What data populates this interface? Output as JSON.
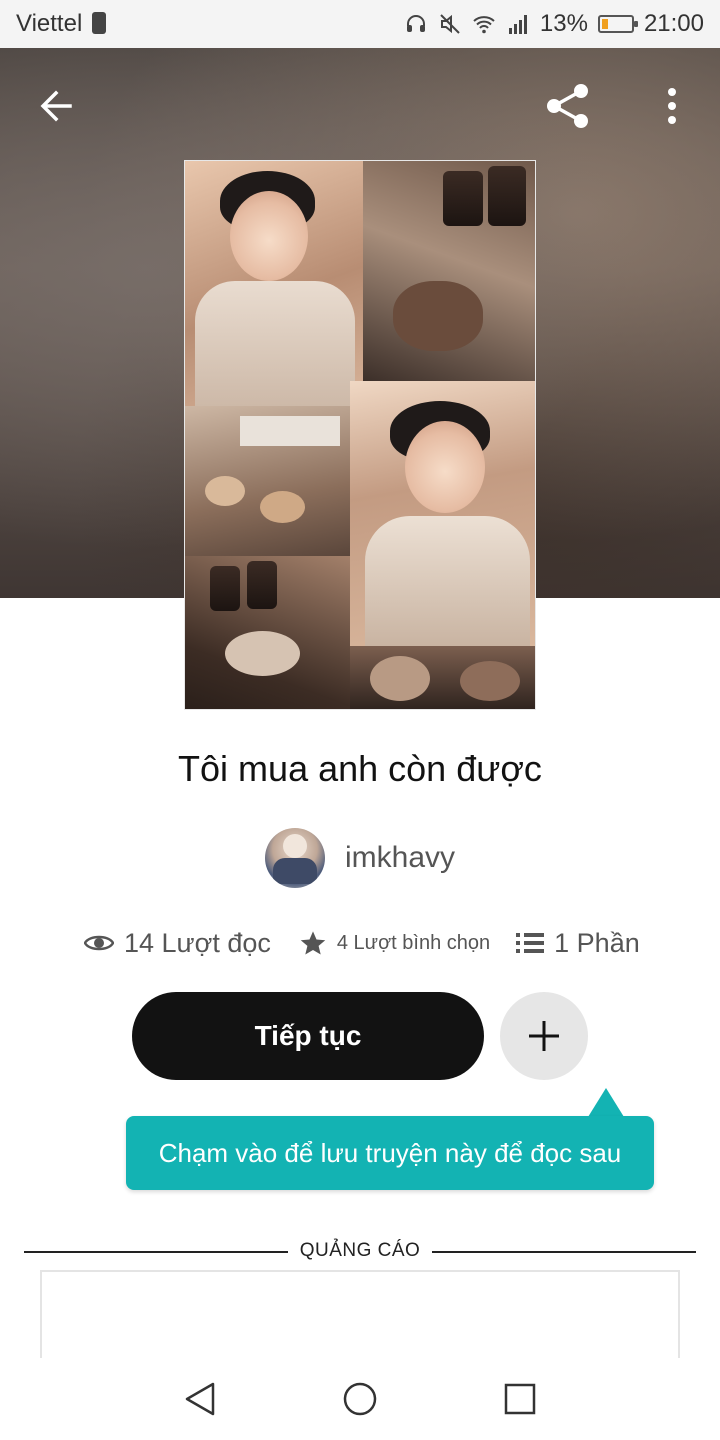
{
  "status_bar": {
    "carrier": "Viettel",
    "battery_percent": "13%",
    "time": "21:00",
    "icons": [
      "headset-icon",
      "mute-icon",
      "wifi-icon",
      "signal-icon",
      "battery-icon"
    ]
  },
  "header": {
    "icons": [
      "back-arrow-icon",
      "share-icon",
      "more-vert-icon"
    ]
  },
  "story": {
    "title": "Tôi mua anh còn được",
    "author": "imkhavy",
    "reads": "14 Lượt đọc",
    "votes": "4 Lượt bình chọn",
    "parts": "1 Phần"
  },
  "actions": {
    "continue_label": "Tiếp tục",
    "add_icon": "plus-icon"
  },
  "tooltip": {
    "text": "Chạm vào để lưu truyện này để đọc sau"
  },
  "ad": {
    "label": "QUẢNG CÁO"
  },
  "nav_bar": {
    "icons": [
      "nav-back-icon",
      "nav-home-icon",
      "nav-recents-icon"
    ]
  },
  "colors": {
    "accent_teal": "#13b3b3",
    "button_dark": "#121212",
    "add_button_bg": "#e6e6e6"
  }
}
